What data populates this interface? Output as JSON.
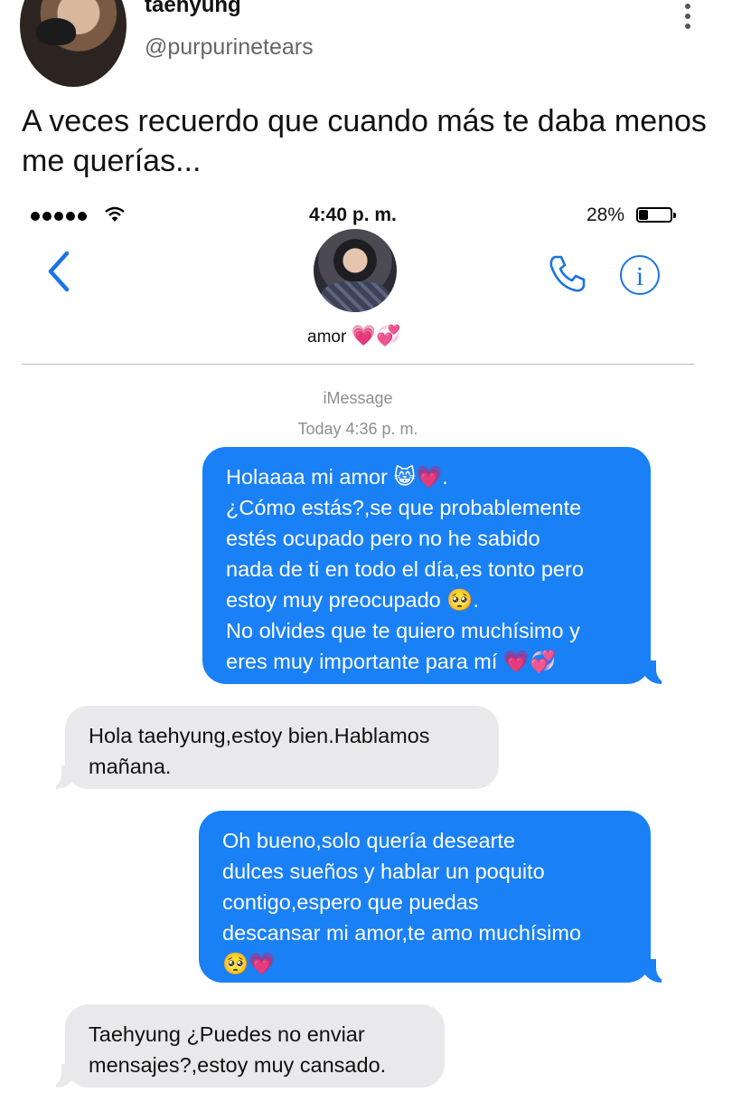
{
  "tweet": {
    "name": "taehyung",
    "handle": "@purpurinetears",
    "text": "A veces recuerdo que cuando más te daba menos me querías..."
  },
  "status_bar": {
    "time": "4:40 p. m.",
    "battery": "28%"
  },
  "contact": {
    "name": "amor",
    "name_emoji": "💗💞"
  },
  "thread": {
    "service": "iMessage",
    "timestamp": "Today 4:36 p. m."
  },
  "messages": [
    {
      "direction": "outgoing",
      "lines": [
        "Holaaaa mi amor 😸💗.",
        "¿Cómo estás?,se que probablemente",
        "estés ocupado pero no he sabido",
        "nada de ti en todo el día,es tonto pero",
        "estoy muy preocupado 🥺.",
        "No olvides que te quiero muchísimo y",
        "eres muy importante para mí 💗💞"
      ]
    },
    {
      "direction": "incoming",
      "lines": [
        "Hola taehyung,estoy bien.Hablamos",
        "mañana."
      ]
    },
    {
      "direction": "outgoing",
      "lines": [
        "Oh bueno,solo quería desearte",
        "dulces sueños y hablar un poquito",
        "contigo,espero que puedas",
        "descansar mi amor,te amo muchísimo",
        "🥺💗"
      ]
    },
    {
      "direction": "incoming",
      "lines": [
        "Taehyung ¿Puedes no enviar",
        "mensajes?,estoy muy cansado."
      ]
    }
  ],
  "colors": {
    "outgoing_bubble": "#1a80f5",
    "incoming_bubble": "#e9e9eb",
    "ios_blue": "#1a73e8"
  },
  "icons": [
    "more-vertical-icon",
    "wifi-icon",
    "battery-icon",
    "back-chevron-icon",
    "phone-icon",
    "info-icon"
  ]
}
